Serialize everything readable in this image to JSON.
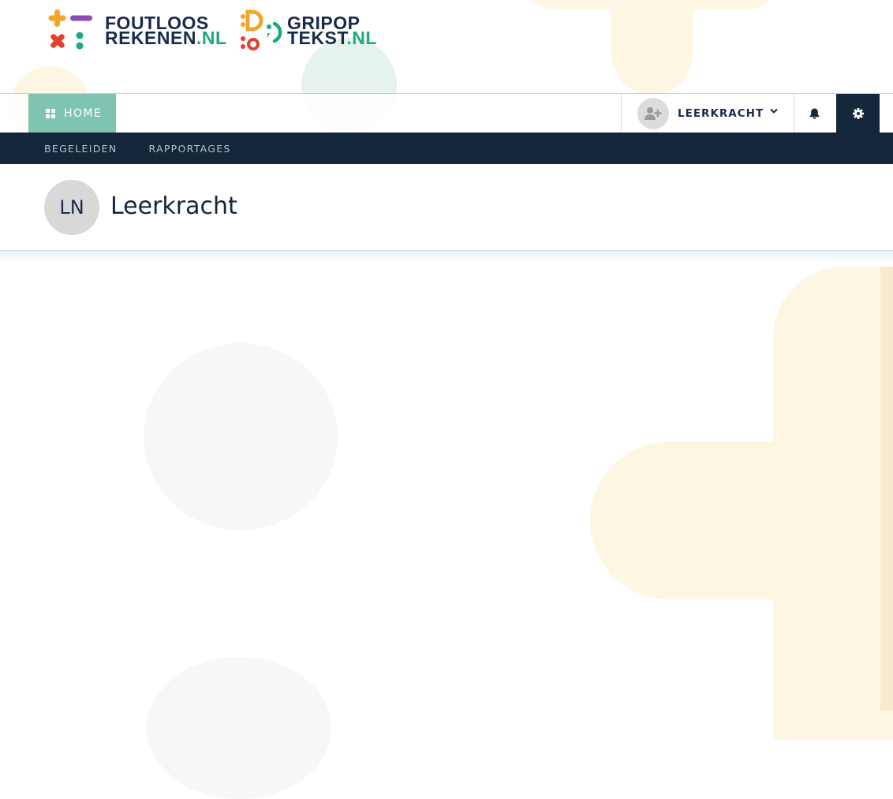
{
  "brand": {
    "logo1": {
      "line1": "FOUTLOOS",
      "line2_main": "REKENEN",
      "line2_suffix": ".NL"
    },
    "logo2": {
      "line1": "GRIPOP",
      "line2_main": "TEKST",
      "line2_suffix": ".NL"
    }
  },
  "nav": {
    "home_label": "HOME",
    "home_icon": "grid-icon",
    "user": {
      "name": "LEERKRACHT",
      "avatar_icon": "user-plus-icon",
      "dropdown_icon": "chevron-down-icon"
    },
    "notifications_icon": "bell-icon",
    "settings_icon": "gear-icon"
  },
  "subnav": {
    "items": [
      {
        "label": "BEGELEIDEN"
      },
      {
        "label": "RAPPORTAGES"
      }
    ]
  },
  "header": {
    "initials": "LN",
    "title": "Leerkracht"
  },
  "colors": {
    "accent_green": "#7ec4b0",
    "navy": "#13263a",
    "brand_green": "#1ea97c",
    "brand_orange": "#f2a52b",
    "brand_purple": "#8a4db0",
    "brand_red": "#e0402c"
  }
}
